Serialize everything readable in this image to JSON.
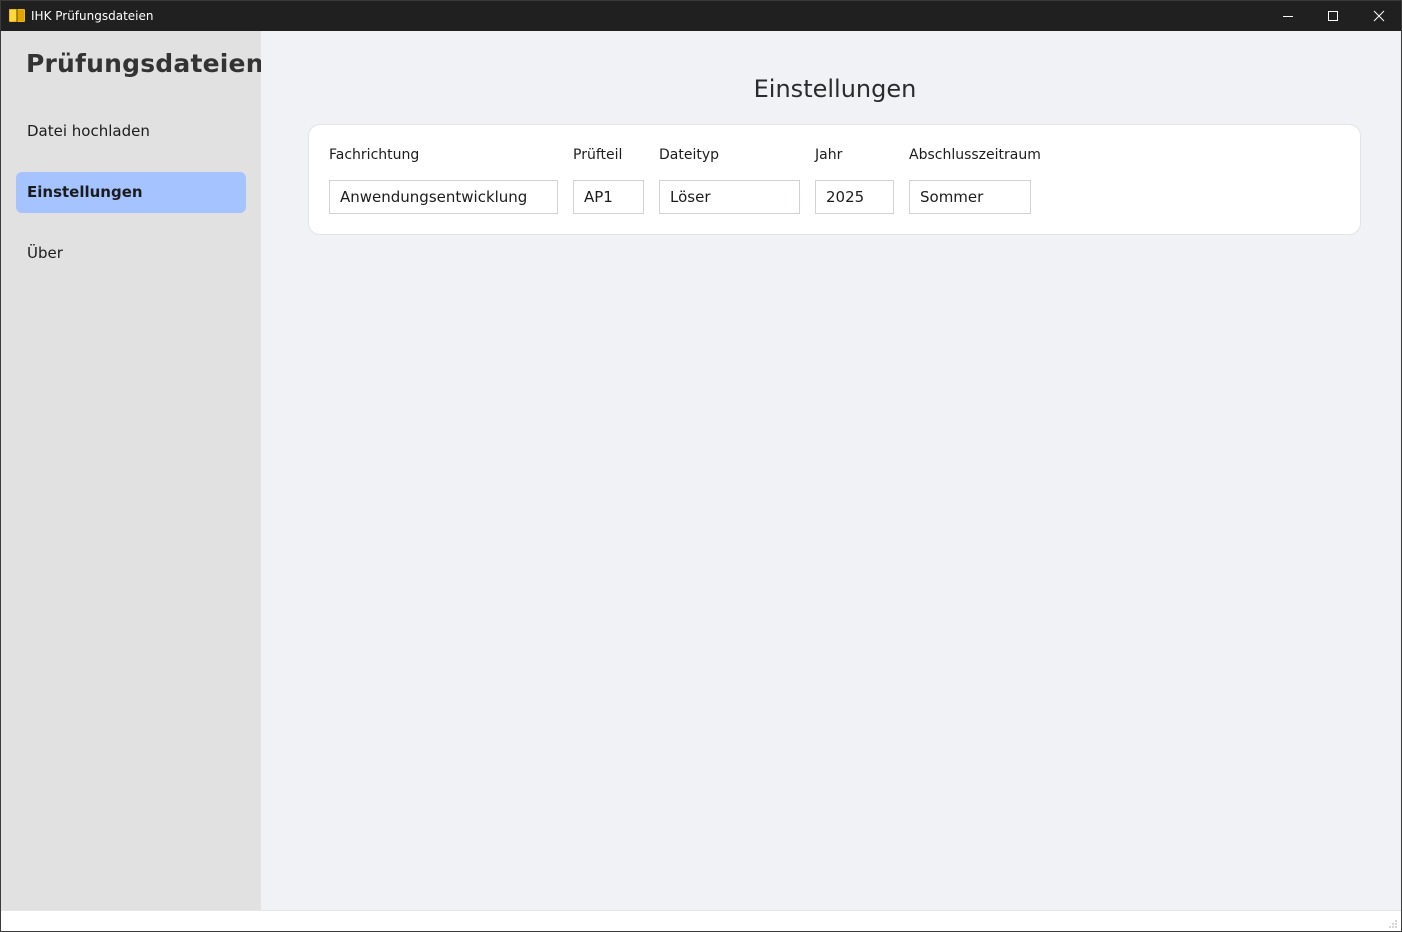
{
  "window": {
    "title": "IHK Prüfungsdateien",
    "controls": {
      "minimize": "minimize-icon",
      "maximize": "maximize-icon",
      "close": "close-icon"
    }
  },
  "sidebar": {
    "title": "Prüfungsdateien",
    "items": [
      {
        "label": "Datei hochladen",
        "active": false
      },
      {
        "label": "Einstellungen",
        "active": true
      },
      {
        "label": "Über",
        "active": false
      }
    ],
    "active_color": "#a5c3ff"
  },
  "main": {
    "title": "Einstellungen",
    "fields": [
      {
        "label": "Fachrichtung",
        "value": "Anwendungsentwicklung"
      },
      {
        "label": "Prüfteil",
        "value": "AP1"
      },
      {
        "label": "Dateityp",
        "value": "Löser"
      },
      {
        "label": "Jahr",
        "value": "2025"
      },
      {
        "label": "Abschlusszeitraum",
        "value": "Sommer"
      }
    ]
  },
  "colors": {
    "titlebar": "#202020",
    "sidebar": "#e1e1e1",
    "main_bg": "#f0f2f5",
    "card_bg": "#ffffff"
  }
}
